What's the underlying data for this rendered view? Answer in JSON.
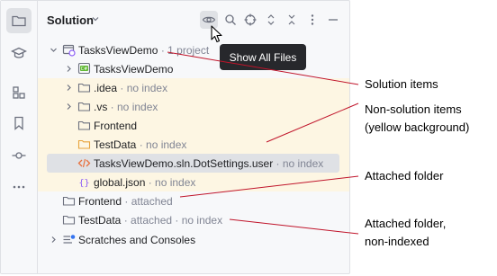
{
  "panel": {
    "title": "Solution",
    "tooltip": "Show All Files"
  },
  "tree": [
    {
      "label": "TasksViewDemo",
      "hint": " · 1 project",
      "icon": "solution-icon"
    },
    {
      "label": "TasksViewDemo",
      "hint": "",
      "icon": "csharp-project-icon"
    },
    {
      "label": ".idea",
      "hint": " · no index",
      "icon": "folder-icon"
    },
    {
      "label": ".vs",
      "hint": " · no index",
      "icon": "folder-icon"
    },
    {
      "label": "Frontend",
      "hint": "",
      "icon": "folder-icon"
    },
    {
      "label": "TestData",
      "hint": " · no index",
      "icon": "folder-icon"
    },
    {
      "label": "TasksViewDemo.sln.DotSettings.user",
      "hint": " · no index",
      "icon": "xml-file-icon"
    },
    {
      "label": "global.json",
      "hint": " · no index",
      "icon": "json-file-icon"
    },
    {
      "label": "Frontend",
      "hint": " · attached",
      "icon": "folder-icon"
    },
    {
      "label": "TestData",
      "hint": " · attached · no index",
      "icon": "folder-icon"
    },
    {
      "label": "Scratches and Consoles",
      "hint": "",
      "icon": "scratches-icon"
    }
  ],
  "annotations": {
    "solution_items": "Solution items",
    "non_solution_line1": "Non-solution items",
    "non_solution_line2": "(yellow background)",
    "attached_folder": "Attached folder",
    "attached_nonindexed_line1": "Attached folder,",
    "attached_nonindexed_line2": "non-indexed"
  },
  "colors": {
    "yellow_background": "#fdf6e3",
    "selection": "#dfe1e5",
    "annotation_line": "#c0142a",
    "hint_text": "#818594"
  }
}
